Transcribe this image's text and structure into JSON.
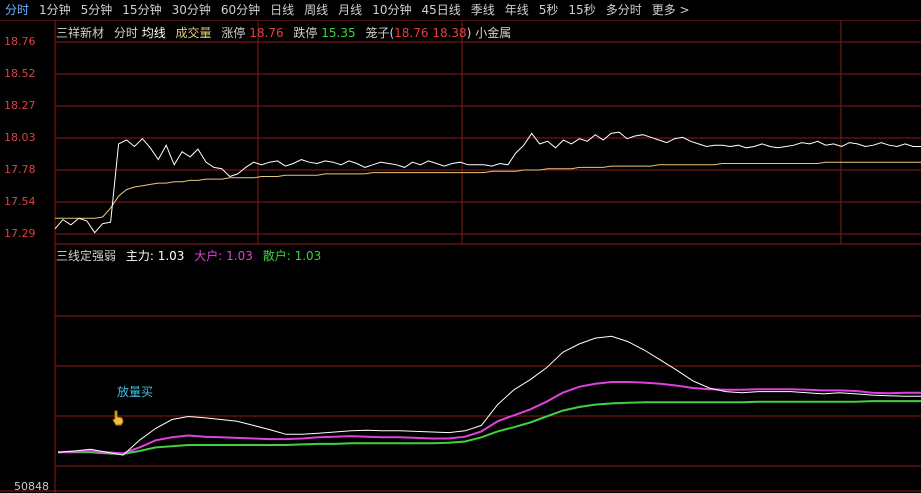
{
  "tabs": [
    "分时",
    "1分钟",
    "5分钟",
    "15分钟",
    "30分钟",
    "60分钟",
    "日线",
    "周线",
    "月线",
    "10分钟",
    "45日线",
    "季线",
    "年线",
    "5秒",
    "15秒",
    "多分时",
    "更多 >"
  ],
  "active_tab": 0,
  "price_header": {
    "stock_name": "三祥新材",
    "mode": "分时",
    "avg_label": "均线",
    "vol_label": "成交量",
    "limit_up_label": "涨停",
    "limit_up_value": "18.76",
    "limit_down_label": "跌停",
    "limit_down_value": "15.35",
    "cage_label": "笼子(",
    "cage_low": "18.76",
    "cage_high": "18.38",
    "cage_close": ")",
    "sector": "小金属"
  },
  "price_axis": [
    "18.76",
    "18.52",
    "18.27",
    "18.03",
    "17.78",
    "17.54",
    "17.29"
  ],
  "indicator_header": {
    "name": "三线定强弱",
    "main_label": "主力:",
    "main_value": "1.03",
    "big_label": "大户:",
    "big_value": "1.03",
    "retail_label": "散户:",
    "retail_value": "1.03"
  },
  "annotation": "放量买",
  "bottom_label": "50848",
  "colors": {
    "grid": "#8b1a1a",
    "price": "#ffffff",
    "avg": "#e8c87a",
    "main": "#ffffff",
    "big": "#e040e0",
    "retail": "#40d040",
    "annotation": "#40c0e0",
    "up": "#e04040",
    "down": "#40d040"
  },
  "chart_data": {
    "type": "line",
    "y_range": [
      17.29,
      18.76
    ],
    "price": [
      17.33,
      17.4,
      17.36,
      17.41,
      17.39,
      17.3,
      17.37,
      17.38,
      17.98,
      18.01,
      17.96,
      18.02,
      17.95,
      17.86,
      17.97,
      17.82,
      17.92,
      17.88,
      17.94,
      17.84,
      17.8,
      17.79,
      17.73,
      17.75,
      17.8,
      17.84,
      17.82,
      17.84,
      17.85,
      17.81,
      17.83,
      17.86,
      17.84,
      17.83,
      17.85,
      17.84,
      17.82,
      17.85,
      17.83,
      17.8,
      17.82,
      17.84,
      17.83,
      17.82,
      17.8,
      17.84,
      17.82,
      17.85,
      17.83,
      17.81,
      17.83,
      17.84,
      17.82,
      17.82,
      17.82,
      17.81,
      17.83,
      17.82,
      17.91,
      17.97,
      18.06,
      17.98,
      18.0,
      17.95,
      18.01,
      17.98,
      18.02,
      18.0,
      18.05,
      18.01,
      18.06,
      18.07,
      18.02,
      18.04,
      18.05,
      18.03,
      18.01,
      17.99,
      18.02,
      18.03,
      18.0,
      17.98,
      17.96,
      17.97,
      17.97,
      17.96,
      17.97,
      17.95,
      17.96,
      17.98,
      17.96,
      17.95,
      17.96,
      17.97,
      17.99,
      17.98,
      18.0,
      17.97,
      17.98,
      17.96,
      17.99,
      17.98,
      17.96,
      17.97,
      17.99,
      17.97,
      17.96,
      17.98,
      17.96,
      17.96
    ],
    "avg": [
      17.41,
      17.41,
      17.41,
      17.41,
      17.41,
      17.41,
      17.42,
      17.49,
      17.58,
      17.63,
      17.65,
      17.66,
      17.67,
      17.68,
      17.68,
      17.69,
      17.69,
      17.7,
      17.7,
      17.71,
      17.71,
      17.71,
      17.72,
      17.72,
      17.72,
      17.72,
      17.73,
      17.73,
      17.73,
      17.74,
      17.74,
      17.74,
      17.74,
      17.74,
      17.75,
      17.75,
      17.75,
      17.75,
      17.75,
      17.75,
      17.76,
      17.76,
      17.76,
      17.76,
      17.76,
      17.76,
      17.76,
      17.76,
      17.76,
      17.76,
      17.76,
      17.76,
      17.76,
      17.76,
      17.76,
      17.77,
      17.77,
      17.77,
      17.77,
      17.78,
      17.78,
      17.78,
      17.79,
      17.79,
      17.79,
      17.79,
      17.8,
      17.8,
      17.8,
      17.8,
      17.81,
      17.81,
      17.81,
      17.81,
      17.81,
      17.81,
      17.82,
      17.82,
      17.82,
      17.82,
      17.82,
      17.82,
      17.82,
      17.82,
      17.83,
      17.83,
      17.83,
      17.83,
      17.83,
      17.83,
      17.83,
      17.83,
      17.83,
      17.83,
      17.83,
      17.83,
      17.83,
      17.84,
      17.84,
      17.84,
      17.84,
      17.84,
      17.84,
      17.84,
      17.84,
      17.84,
      17.84,
      17.84,
      17.84,
      17.84
    ],
    "ind_main": [
      0.3,
      0.32,
      0.35,
      0.3,
      0.25,
      0.5,
      0.7,
      0.85,
      0.9,
      0.88,
      0.85,
      0.82,
      0.75,
      0.68,
      0.6,
      0.6,
      0.62,
      0.64,
      0.66,
      0.67,
      0.66,
      0.66,
      0.65,
      0.64,
      0.63,
      0.66,
      0.75,
      1.1,
      1.35,
      1.52,
      1.72,
      1.98,
      2.12,
      2.22,
      2.25,
      2.16,
      2.02,
      1.85,
      1.68,
      1.5,
      1.38,
      1.32,
      1.3,
      1.32,
      1.32,
      1.32,
      1.3,
      1.28,
      1.3,
      1.28,
      1.26,
      1.25,
      1.24,
      1.24
    ],
    "ind_big": [
      0.3,
      0.31,
      0.32,
      0.3,
      0.28,
      0.38,
      0.5,
      0.55,
      0.58,
      0.56,
      0.55,
      0.54,
      0.53,
      0.52,
      0.52,
      0.53,
      0.55,
      0.56,
      0.57,
      0.56,
      0.55,
      0.55,
      0.54,
      0.53,
      0.53,
      0.56,
      0.65,
      0.82,
      0.92,
      1.02,
      1.15,
      1.3,
      1.4,
      1.45,
      1.48,
      1.48,
      1.47,
      1.45,
      1.42,
      1.38,
      1.36,
      1.35,
      1.35,
      1.36,
      1.36,
      1.36,
      1.35,
      1.34,
      1.34,
      1.33,
      1.3,
      1.29,
      1.3,
      1.3
    ],
    "ind_retail": [
      0.3,
      0.3,
      0.3,
      0.28,
      0.27,
      0.32,
      0.38,
      0.4,
      0.42,
      0.42,
      0.42,
      0.42,
      0.42,
      0.42,
      0.42,
      0.43,
      0.44,
      0.44,
      0.45,
      0.45,
      0.45,
      0.45,
      0.45,
      0.45,
      0.46,
      0.48,
      0.55,
      0.65,
      0.72,
      0.8,
      0.9,
      1.0,
      1.06,
      1.1,
      1.12,
      1.13,
      1.14,
      1.14,
      1.14,
      1.14,
      1.14,
      1.14,
      1.14,
      1.15,
      1.15,
      1.15,
      1.15,
      1.15,
      1.15,
      1.15,
      1.16,
      1.16,
      1.16,
      1.16
    ],
    "ind_range": [
      0,
      3.5
    ]
  }
}
